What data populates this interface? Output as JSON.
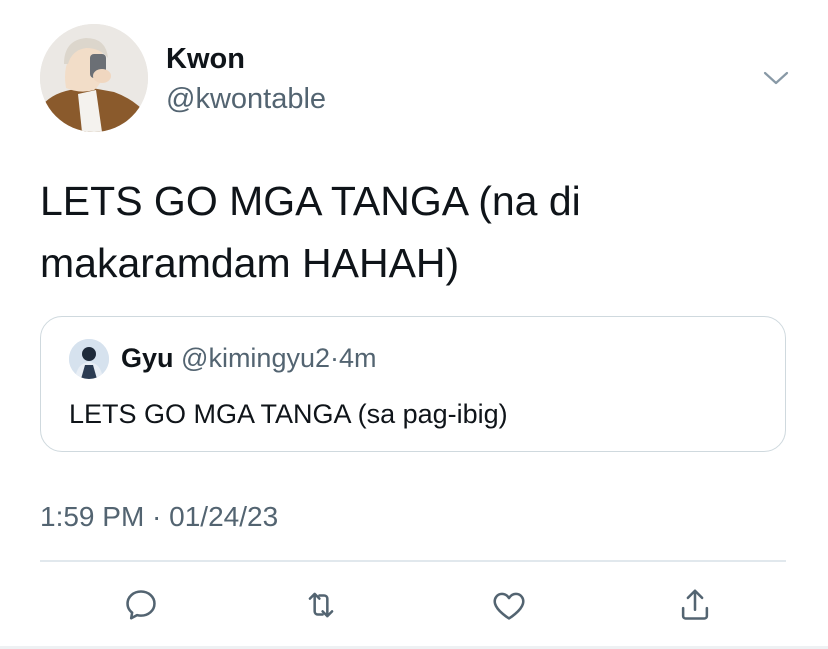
{
  "tweet": {
    "author": {
      "display_name": "Kwon",
      "handle": "@kwontable",
      "avatar_icon": "profile-photo"
    },
    "text": "LETS GO MGA TANGA (na di makaramdam HAHAH)",
    "timestamp": "1:59 PM · 01/24/23",
    "menu_icon": "chevron-down-icon"
  },
  "quoted_tweet": {
    "display_name": "Gyu",
    "handle": "@kimingyu2",
    "separator": "·",
    "time": "4m",
    "text": "LETS GO MGA TANGA (sa pag-ibig)"
  },
  "actions": [
    {
      "name": "reply",
      "icon": "speech-bubble-icon"
    },
    {
      "name": "retweet",
      "icon": "retweet-icon"
    },
    {
      "name": "like",
      "icon": "heart-icon"
    },
    {
      "name": "share",
      "icon": "share-icon"
    }
  ],
  "colors": {
    "text_primary": "#0f1419",
    "text_secondary": "#536471",
    "border": "#cfd9de",
    "icon": "#536471"
  }
}
